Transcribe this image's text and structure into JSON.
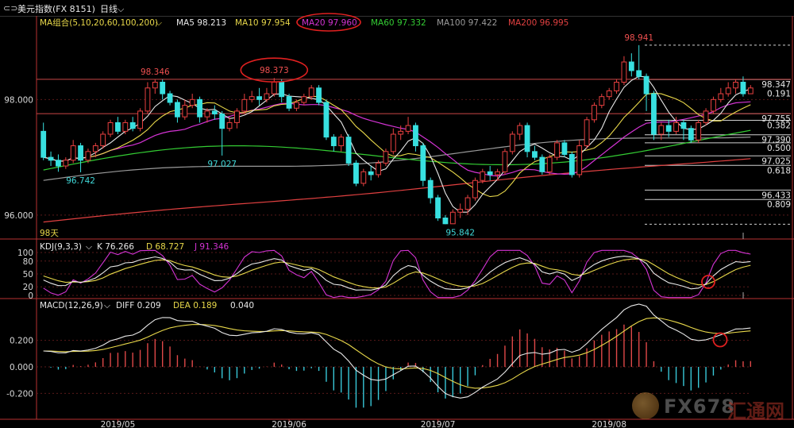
{
  "topbar": {
    "title": "美元指数(FX 8151)",
    "period": "日线",
    "period_arrow": "⌵"
  },
  "ma_legend": [
    {
      "label": "MA组合(5,10,20,60,100,200)",
      "color": "#e8d84a"
    },
    {
      "label": "MA5 98.213",
      "color": "#e8e8e8"
    },
    {
      "label": "MA10 97.954",
      "color": "#e8d84a"
    },
    {
      "label": "MA20 97.960",
      "color": "#d433d4"
    },
    {
      "label": "MA60 97.332",
      "color": "#33cc33"
    },
    {
      "label": "MA100 97.422",
      "color": "#9a9a9a"
    },
    {
      "label": "MA200 96.995",
      "color": "#e04040"
    }
  ],
  "kdj_legend": [
    {
      "label": "KDJ(9,3,3)",
      "color": "#e8e8e8"
    },
    {
      "label": "K 76.266",
      "color": "#e8e8e8"
    },
    {
      "label": "D 68.727",
      "color": "#e8d84a"
    },
    {
      "label": "J 91.346",
      "color": "#d433d4"
    }
  ],
  "macd_legend": [
    {
      "label": "MACD(12,26,9)",
      "color": "#e8e8e8"
    },
    {
      "label": "DIFF 0.209",
      "color": "#e8e8e8"
    },
    {
      "label": "DEA 0.189",
      "color": "#e8d84a"
    },
    {
      "label": "0.040",
      "color": "#e8e8e8"
    }
  ],
  "price_axis_labels": [
    {
      "label": "98.000",
      "value": 98.0
    },
    {
      "label": "96.000",
      "value": 96.0
    }
  ],
  "kdj_axis_labels": [
    {
      "label": "100",
      "value": 100
    },
    {
      "label": "80",
      "value": 80
    },
    {
      "label": "50",
      "value": 50
    },
    {
      "label": "20",
      "value": 20
    },
    {
      "label": "0",
      "value": 0
    }
  ],
  "macd_axis_labels": [
    {
      "label": "0.200",
      "value": 0.2
    },
    {
      "label": "0.000",
      "value": 0.0
    },
    {
      "label": "-0.200",
      "value": -0.2
    }
  ],
  "date_labels": [
    {
      "label": "2019/05",
      "index": 10
    },
    {
      "label": "2019/06",
      "index": 33
    },
    {
      "label": "2019/07",
      "index": 53
    },
    {
      "label": "2019/08",
      "index": 76
    }
  ],
  "days_label": "98天",
  "price_annotations": [
    {
      "label": "98.346",
      "index": 15,
      "value": 98.346,
      "pos": "above"
    },
    {
      "label": "98.373",
      "index": 31,
      "value": 98.373,
      "pos": "above"
    },
    {
      "label": "98.941",
      "index": 80,
      "value": 98.941,
      "pos": "above"
    },
    {
      "label": "97.027",
      "index": 24,
      "value": 97.027,
      "pos": "below"
    },
    {
      "label": "96.742",
      "index": 5,
      "value": 96.742,
      "pos": "below"
    },
    {
      "label": "95.842",
      "index": 56,
      "value": 95.842,
      "pos": "below"
    }
  ],
  "right_levels": [
    {
      "label": "98.347",
      "value": 98.347,
      "style": "solid"
    },
    {
      "label": "0.191",
      "value": 98.191,
      "style": "none"
    },
    {
      "label": "97.755",
      "value": 97.755,
      "style": "solid"
    },
    {
      "label": "0.382",
      "value": 97.64,
      "style": "solid"
    },
    {
      "label": "97.390",
      "value": 97.39,
      "style": "solid"
    },
    {
      "label": "0.500",
      "value": 97.25,
      "style": "solid"
    },
    {
      "label": "97.025",
      "value": 97.025,
      "style": "solid"
    },
    {
      "label": "0.618",
      "value": 96.86,
      "style": "solid"
    },
    {
      "label": "96.433",
      "value": 96.433,
      "style": "solid"
    },
    {
      "label": "0.809",
      "value": 96.27,
      "style": "solid"
    }
  ],
  "watermark": {
    "brand": "FX678",
    "cn": "汇通网"
  },
  "chart_data": {
    "type": "candlestick",
    "title": "美元指数(FX 8151)",
    "period": "日线",
    "xlabel": "",
    "ylabel": "",
    "ylim": [
      95.6,
      99.2
    ],
    "x_ticks": [
      "2019/05",
      "2019/06",
      "2019/07",
      "2019/08"
    ],
    "candles": [
      [
        97.45,
        97.0,
        97.6,
        96.95
      ],
      [
        97.0,
        96.95,
        97.1,
        96.85
      ],
      [
        96.95,
        96.85,
        97.05,
        96.75
      ],
      [
        96.85,
        96.95,
        97.0,
        96.8
      ],
      [
        96.95,
        97.2,
        97.3,
        96.9
      ],
      [
        97.2,
        96.95,
        97.25,
        96.74
      ],
      [
        96.95,
        97.1,
        97.15,
        96.9
      ],
      [
        97.1,
        97.2,
        97.25,
        97.0
      ],
      [
        97.2,
        97.4,
        97.45,
        97.15
      ],
      [
        97.4,
        97.6,
        97.65,
        97.35
      ],
      [
        97.6,
        97.45,
        97.7,
        97.4
      ],
      [
        97.45,
        97.6,
        97.65,
        97.4
      ],
      [
        97.6,
        97.5,
        97.7,
        97.45
      ],
      [
        97.5,
        97.8,
        97.85,
        97.45
      ],
      [
        97.8,
        98.2,
        98.3,
        97.75
      ],
      [
        98.2,
        98.3,
        98.346,
        98.1
      ],
      [
        98.3,
        98.1,
        98.35,
        98.0
      ],
      [
        98.1,
        97.95,
        98.15,
        97.9
      ],
      [
        97.95,
        97.7,
        98.0,
        97.6
      ],
      [
        97.7,
        97.9,
        98.0,
        97.65
      ],
      [
        97.9,
        98.0,
        98.1,
        97.85
      ],
      [
        98.0,
        97.7,
        98.05,
        97.6
      ],
      [
        97.7,
        97.8,
        97.85,
        97.6
      ],
      [
        97.8,
        97.75,
        97.9,
        97.65
      ],
      [
        97.75,
        97.5,
        97.8,
        97.03
      ],
      [
        97.5,
        97.6,
        97.7,
        97.45
      ],
      [
        97.6,
        97.8,
        97.85,
        97.5
      ],
      [
        97.8,
        98.0,
        98.1,
        97.75
      ],
      [
        98.0,
        98.05,
        98.15,
        97.95
      ],
      [
        98.05,
        98.0,
        98.2,
        97.9
      ],
      [
        98.0,
        98.1,
        98.2,
        97.95
      ],
      [
        98.1,
        98.3,
        98.373,
        98.05
      ],
      [
        98.3,
        98.05,
        98.35,
        97.95
      ],
      [
        98.05,
        97.85,
        98.1,
        97.8
      ],
      [
        97.85,
        97.95,
        98.0,
        97.8
      ],
      [
        97.95,
        98.05,
        98.1,
        97.9
      ],
      [
        98.05,
        98.2,
        98.25,
        98.0
      ],
      [
        98.2,
        97.95,
        98.25,
        97.9
      ],
      [
        97.95,
        97.35,
        98.0,
        97.3
      ],
      [
        97.35,
        97.2,
        97.4,
        97.1
      ],
      [
        97.2,
        97.35,
        97.4,
        97.1
      ],
      [
        97.35,
        96.9,
        97.4,
        96.85
      ],
      [
        96.9,
        96.55,
        96.95,
        96.5
      ],
      [
        96.55,
        96.75,
        96.8,
        96.5
      ],
      [
        96.75,
        96.7,
        96.85,
        96.6
      ],
      [
        96.7,
        96.9,
        96.95,
        96.65
      ],
      [
        96.9,
        97.1,
        97.15,
        96.85
      ],
      [
        97.1,
        97.4,
        97.5,
        97.05
      ],
      [
        97.4,
        97.45,
        97.55,
        97.3
      ],
      [
        97.45,
        97.55,
        97.7,
        97.4
      ],
      [
        97.55,
        97.2,
        97.6,
        97.1
      ],
      [
        97.2,
        96.6,
        97.25,
        96.5
      ],
      [
        96.6,
        96.3,
        96.65,
        96.2
      ],
      [
        96.3,
        95.95,
        96.35,
        95.9
      ],
      [
        95.95,
        95.85,
        96.0,
        95.842
      ],
      [
        95.85,
        96.05,
        96.1,
        95.85
      ],
      [
        96.05,
        96.1,
        96.2,
        95.95
      ],
      [
        96.1,
        96.3,
        96.35,
        96.0
      ],
      [
        96.3,
        96.6,
        96.65,
        96.25
      ],
      [
        96.6,
        96.75,
        96.8,
        96.55
      ],
      [
        96.75,
        96.7,
        96.85,
        96.6
      ],
      [
        96.7,
        96.75,
        96.8,
        96.6
      ],
      [
        96.75,
        97.1,
        97.15,
        96.7
      ],
      [
        97.1,
        97.4,
        97.45,
        97.05
      ],
      [
        97.4,
        97.55,
        97.6,
        97.3
      ],
      [
        97.55,
        97.1,
        97.6,
        97.0
      ],
      [
        97.1,
        97.0,
        97.2,
        96.95
      ],
      [
        97.0,
        96.75,
        97.05,
        96.7
      ],
      [
        96.75,
        97.0,
        97.05,
        96.7
      ],
      [
        97.0,
        97.25,
        97.3,
        96.95
      ],
      [
        97.25,
        97.05,
        97.3,
        97.0
      ],
      [
        97.05,
        96.7,
        97.1,
        96.65
      ],
      [
        96.7,
        97.2,
        97.3,
        96.65
      ],
      [
        97.2,
        97.65,
        97.7,
        97.15
      ],
      [
        97.65,
        97.9,
        97.95,
        97.6
      ],
      [
        97.9,
        98.05,
        98.1,
        97.85
      ],
      [
        98.05,
        98.15,
        98.2,
        98.0
      ],
      [
        98.15,
        98.3,
        98.35,
        98.1
      ],
      [
        98.3,
        98.65,
        98.75,
        98.25
      ],
      [
        98.65,
        98.5,
        98.8,
        98.4
      ],
      [
        98.5,
        98.4,
        98.941,
        98.35
      ],
      [
        98.4,
        98.1,
        98.45,
        97.8
      ],
      [
        98.1,
        97.4,
        98.15,
        97.3
      ],
      [
        97.4,
        97.55,
        97.6,
        97.3
      ],
      [
        97.55,
        97.45,
        97.65,
        97.35
      ],
      [
        97.45,
        97.6,
        97.7,
        97.4
      ],
      [
        97.6,
        97.5,
        97.65,
        97.3
      ],
      [
        97.5,
        97.3,
        97.55,
        97.25
      ],
      [
        97.3,
        97.6,
        97.65,
        97.25
      ],
      [
        97.6,
        97.8,
        97.85,
        97.55
      ],
      [
        97.8,
        98.0,
        98.05,
        97.75
      ],
      [
        98.0,
        98.1,
        98.2,
        97.95
      ],
      [
        98.1,
        98.2,
        98.3,
        98.05
      ],
      [
        98.2,
        98.3,
        98.35,
        98.1
      ],
      [
        98.3,
        98.1,
        98.4,
        98.05
      ],
      [
        98.1,
        98.2,
        98.25,
        98.1
      ]
    ],
    "series": [
      {
        "name": "MA5",
        "color": "#e8e8e8"
      },
      {
        "name": "MA10",
        "color": "#e8d84a"
      },
      {
        "name": "MA20",
        "color": "#d433d4"
      },
      {
        "name": "MA60",
        "color": "#33cc33"
      },
      {
        "name": "MA100",
        "color": "#9a9a9a"
      },
      {
        "name": "MA200",
        "color": "#e04040"
      }
    ],
    "ma60_start": 96.78,
    "ma60_end": 97.332,
    "ma100_start": 96.6,
    "ma100_end": 97.422,
    "ma200_start": 95.88,
    "ma200_end": 96.995,
    "kdj": {
      "K": 76.266,
      "D": 68.727,
      "J": 91.346,
      "ylim": [
        0,
        100
      ]
    },
    "macd": {
      "DIFF": 0.209,
      "DEA": 0.189,
      "MACD": 0.04,
      "ylim": [
        -0.36,
        0.42
      ]
    }
  }
}
